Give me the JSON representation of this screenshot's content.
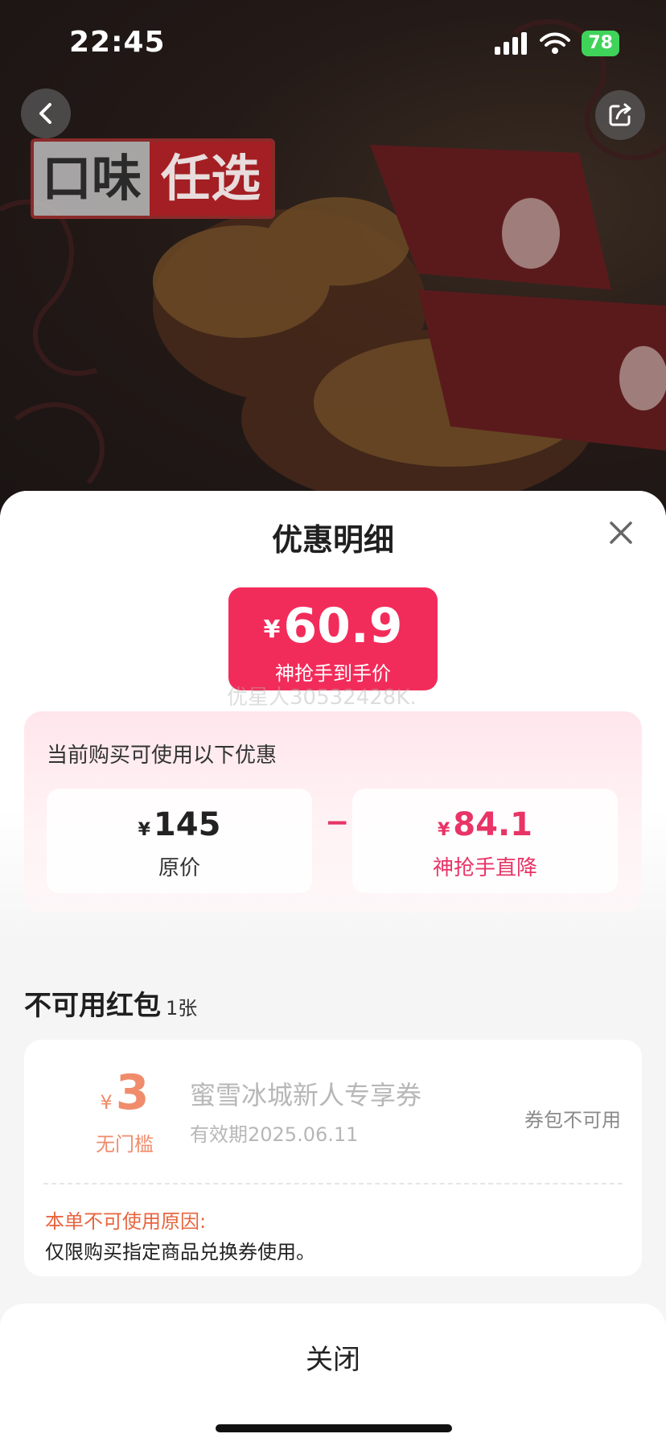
{
  "status_bar": {
    "time": "22:45",
    "battery": "78"
  },
  "hero": {
    "promo_part1": "口味",
    "promo_part2": "任选"
  },
  "sheet": {
    "title": "优惠明细",
    "final_price": {
      "currency": "¥",
      "value": "60.9",
      "label": "神抢手到手价"
    },
    "watermark": "优星人30532428K.",
    "discount": {
      "title": "当前购买可使用以下优惠",
      "original": {
        "currency": "¥",
        "value": "145",
        "label": "原价"
      },
      "operator": "−",
      "reduction": {
        "currency": "¥",
        "value": "84.1",
        "label": "神抢手直降"
      }
    },
    "unavailable_section": {
      "title": "不可用红包",
      "count": "1张"
    },
    "coupon": {
      "currency": "¥",
      "amount": "3",
      "condition": "无门槛",
      "name": "蜜雪冰城新人专享券",
      "validity": "有效期2025.06.11",
      "status": "券包不可用",
      "reason_title": "本单不可使用原因:",
      "reason_text": "仅限购买指定商品兑换券使用。"
    },
    "close_button": "关闭"
  },
  "colors": {
    "accent": "#f22c5a",
    "reduction_text": "#e83466",
    "coupon_orange": "#f08c6c"
  },
  "icons": [
    "back-arrow-icon",
    "share-icon",
    "close-icon",
    "signal-icon",
    "wifi-icon",
    "battery-icon"
  ]
}
